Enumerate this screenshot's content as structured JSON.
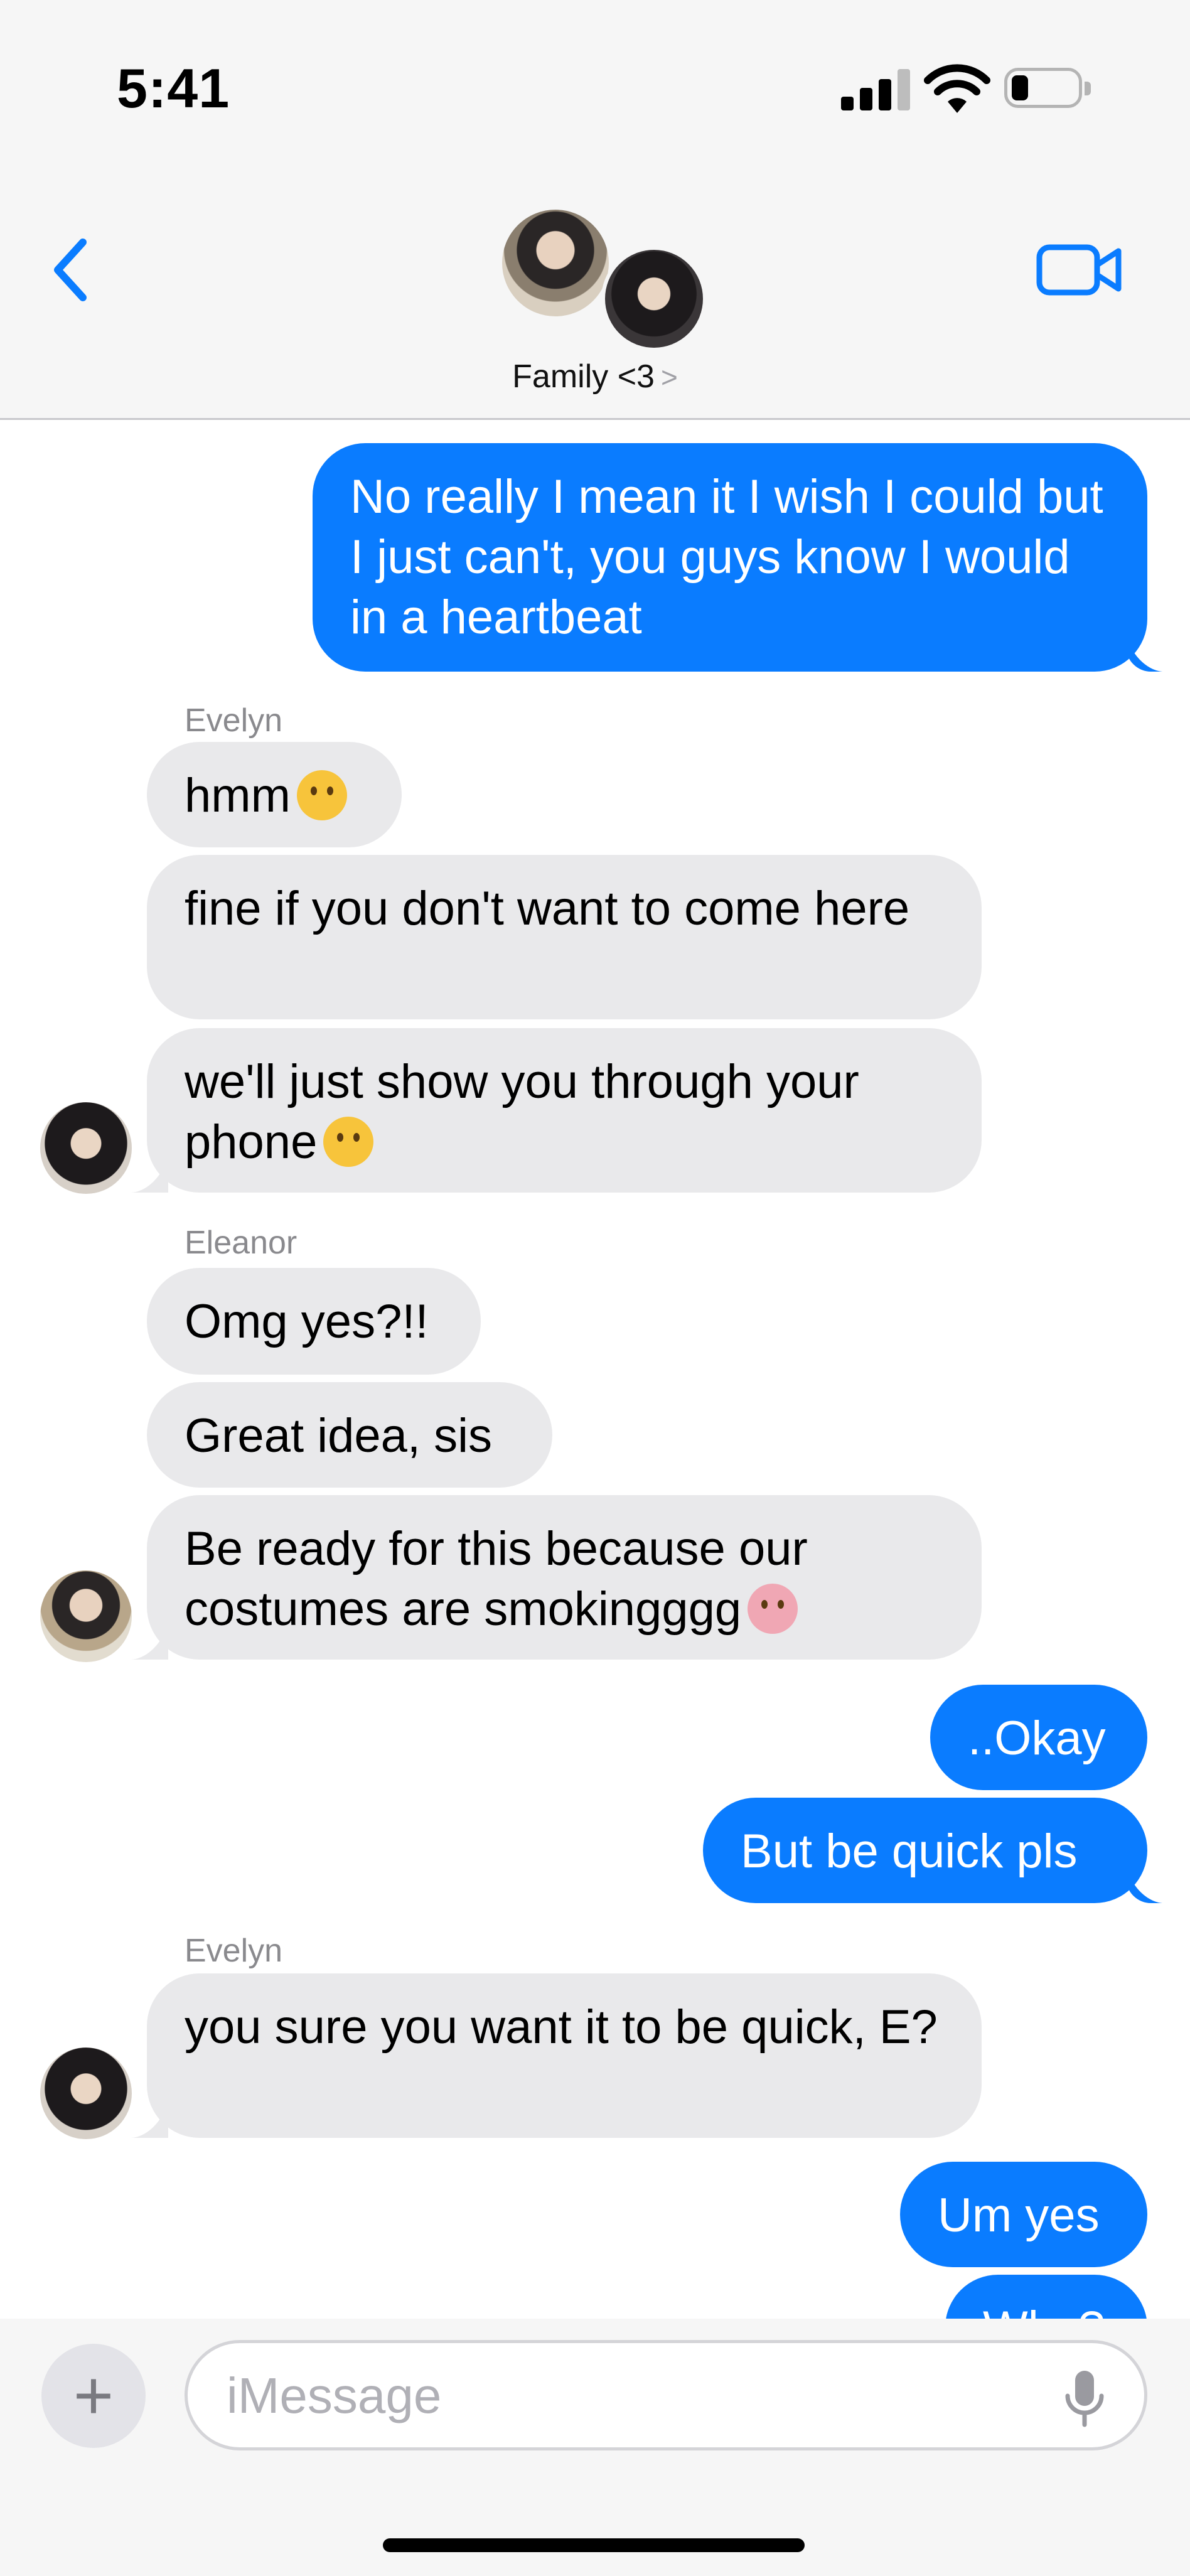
{
  "status": {
    "time": "5:41"
  },
  "header": {
    "group_name": "Family <3",
    "chevron": ">"
  },
  "messages": [
    {
      "from": "me",
      "text": "No really I mean it I wish I could but I just can't, you guys know I would in a heartbeat"
    },
    {
      "sender": "Evelyn",
      "text": "hmm",
      "emoji": "thinking-face"
    },
    {
      "sender": "Evelyn",
      "text": "fine if you don't want to come here"
    },
    {
      "sender": "Evelyn",
      "text": "we'll just show you through your phone",
      "emoji": "winking-face"
    },
    {
      "sender": "Eleanor",
      "text": "Omg yes?!!"
    },
    {
      "sender": "Eleanor",
      "text": "Great idea, sis"
    },
    {
      "sender": "Eleanor",
      "text": "Be ready for this because our costumes are smokingggg",
      "emoji": "tongue"
    },
    {
      "from": "me",
      "text": "..Okay"
    },
    {
      "from": "me",
      "text": "But be quick pls"
    },
    {
      "sender": "Evelyn",
      "text": "you sure you want it to be quick, E?"
    },
    {
      "from": "me",
      "text": "Um yes"
    },
    {
      "from": "me",
      "text": "Why?"
    }
  ],
  "composer": {
    "placeholder": "iMessage",
    "plus": "+"
  },
  "colors": {
    "outgoing": "#0a7cff",
    "incoming": "#e9e9eb",
    "accent": "#0a7cff"
  }
}
